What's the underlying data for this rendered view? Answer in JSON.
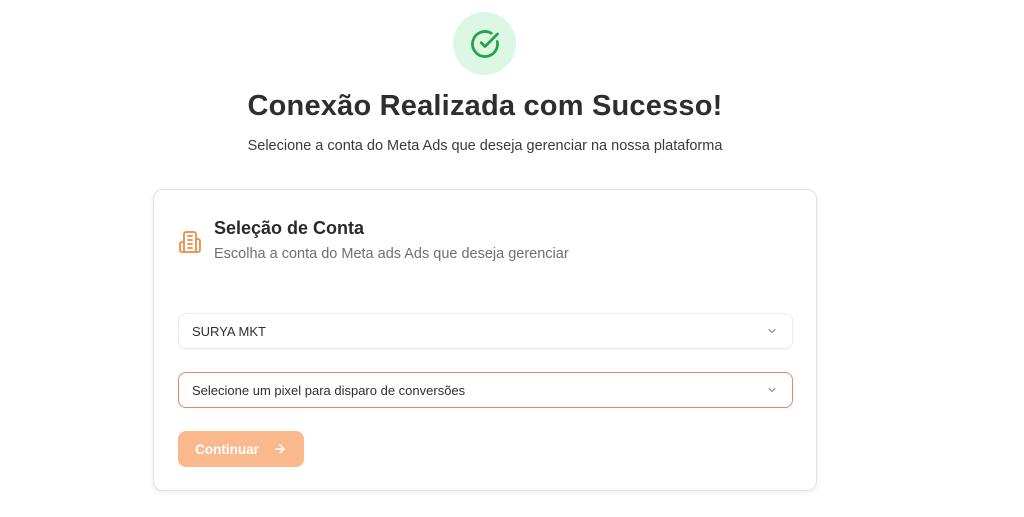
{
  "header": {
    "title": "Conexão Realizada com Sucesso!",
    "subtitle": "Selecione a conta do Meta Ads que deseja gerenciar na nossa plataforma"
  },
  "card": {
    "title": "Seleção de Conta",
    "description": "Escolha a conta do Meta ads Ads que deseja gerenciar",
    "icon": "building-icon",
    "account_select": {
      "value": "SURYA MKT"
    },
    "pixel_select": {
      "placeholder": "Selecione um pixel para disparo de conversões"
    },
    "continue_button": {
      "label": "Continuar",
      "icon": "arrow-right-icon"
    }
  },
  "colors": {
    "success_bg": "#dcf7e3",
    "success_icon": "#22a34a",
    "accent": "#f08a3c",
    "button_disabled": "#f9b98c",
    "pixel_border": "#e08a6d"
  }
}
